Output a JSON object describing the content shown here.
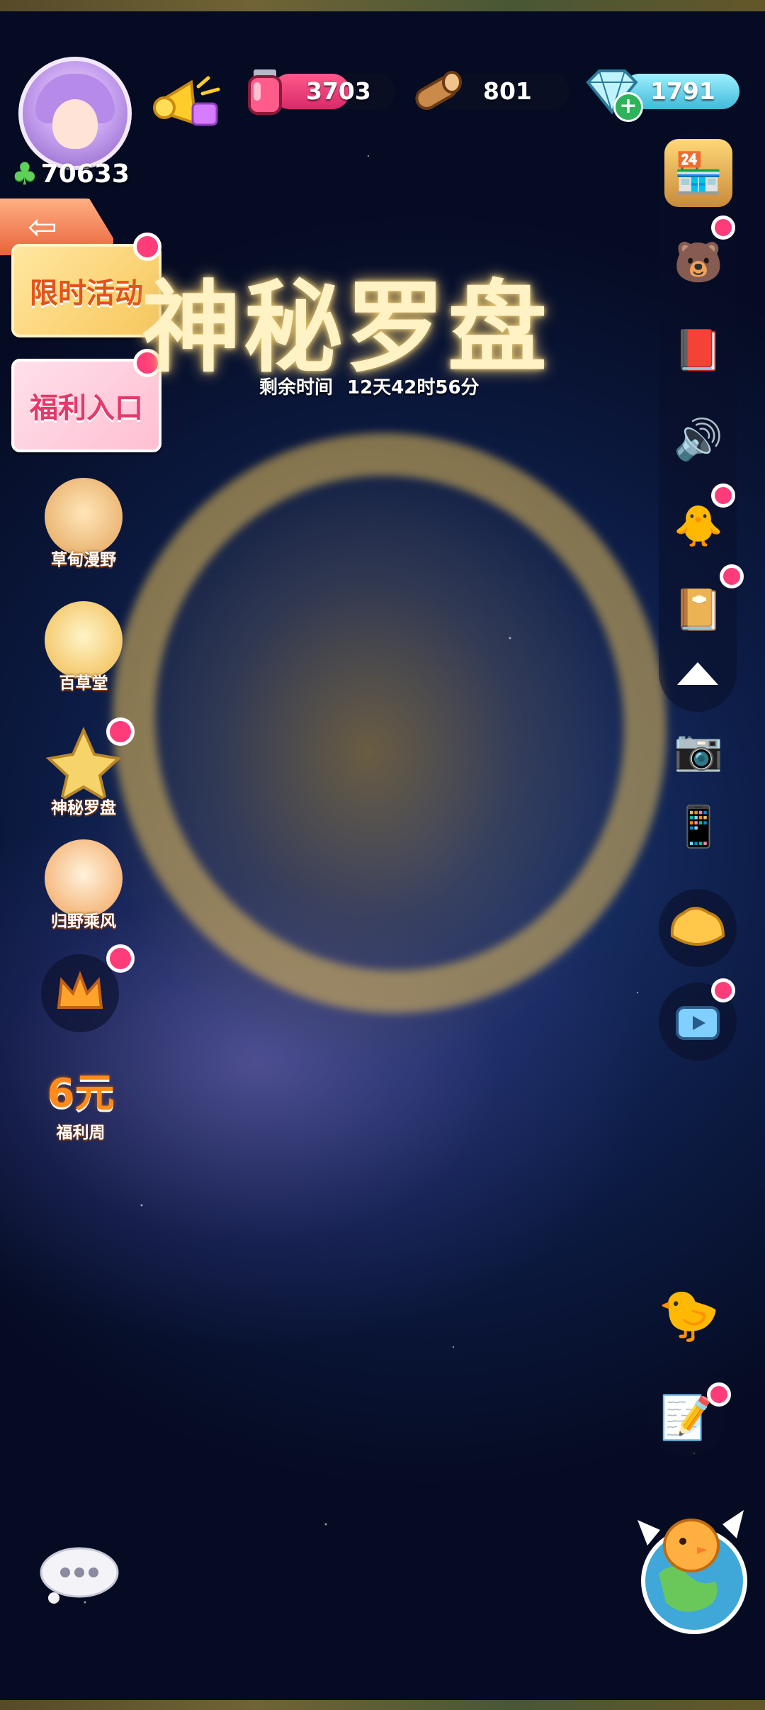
{
  "player": {
    "clover_count": "70633"
  },
  "resources": {
    "potion": {
      "value": "3703"
    },
    "wood": {
      "value": "801"
    },
    "gem": {
      "value": "1791"
    }
  },
  "banners": {
    "limited_event": "限时活动",
    "welfare": "福利入口"
  },
  "event": {
    "title": "神秘罗盘",
    "timer_label": "剩余时间",
    "timer_value": "12天42时56分"
  },
  "left_events": [
    {
      "label": "草甸漫野"
    },
    {
      "label": "百草堂"
    },
    {
      "label": "神秘罗盘"
    },
    {
      "label": "归野乘风"
    },
    {
      "label": ""
    },
    {
      "label": "福利周",
      "badge": "6元"
    }
  ],
  "colors": {
    "accent_pink": "#ff3c7a",
    "gold": "#f7dc8c"
  }
}
